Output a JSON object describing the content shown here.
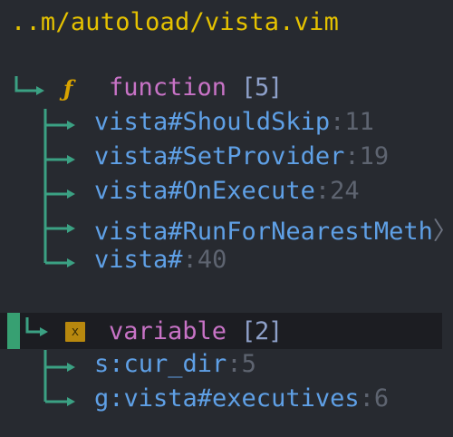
{
  "header": {
    "path": "..m/autoload/vista.vim"
  },
  "groups": [
    {
      "icon": "function-icon",
      "icon_glyph": "ƒ",
      "kind": "function",
      "count": "5",
      "items": [
        {
          "name": "vista#ShouldSkip",
          "line": "11"
        },
        {
          "name": "vista#SetProvider",
          "line": "19"
        },
        {
          "name": "vista#OnExecute",
          "line": "24"
        },
        {
          "name": "vista#RunForNearestMeth",
          "overflow": "〉"
        },
        {
          "name": "vista#",
          "line": "40"
        }
      ]
    },
    {
      "icon": "variable-icon",
      "icon_glyph": "x",
      "kind": "variable",
      "count": "2",
      "items": [
        {
          "name": "s:cur_dir",
          "line": "5"
        },
        {
          "name": "g:vista#executives",
          "line": "6"
        }
      ]
    }
  ],
  "colors": {
    "background": "#272a30",
    "header": "#e5c200",
    "tree": "#3ba183",
    "kind": "#c873c6",
    "tag": "#5fa0e6",
    "line_number": "#5e6470",
    "cursor_line": "#1c1d22",
    "sign": "#37a072"
  }
}
